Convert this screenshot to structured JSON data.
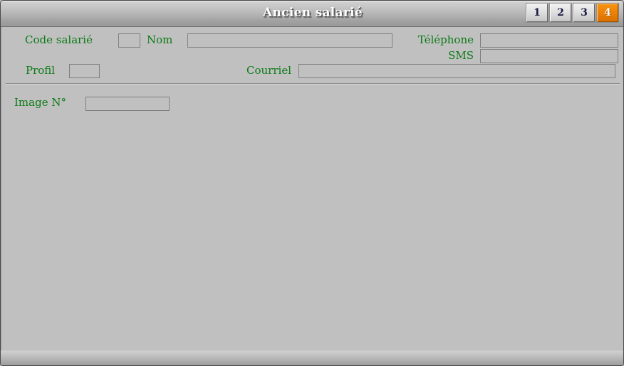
{
  "window": {
    "title": "Ancien salarié"
  },
  "tabs": [
    {
      "label": "1",
      "active": false
    },
    {
      "label": "2",
      "active": false
    },
    {
      "label": "3",
      "active": false
    },
    {
      "label": "4",
      "active": true
    }
  ],
  "form": {
    "code_salarie": {
      "label": "Code salarié",
      "value": "",
      "placeholder": ""
    },
    "nom": {
      "label": "Nom",
      "value": "",
      "placeholder": ""
    },
    "telephone": {
      "label": "Téléphone",
      "value": "",
      "placeholder": ""
    },
    "sms": {
      "label": "SMS",
      "value": "",
      "placeholder": ""
    },
    "profil": {
      "label": "Profil",
      "value": "",
      "placeholder": ""
    },
    "courriel": {
      "label": "Courriel",
      "value": "",
      "placeholder": ""
    },
    "image_no": {
      "label": "Image N°",
      "value": "",
      "placeholder": ""
    }
  },
  "colors": {
    "label_green": "#0b7a14",
    "accent_orange": "#ef8408",
    "surface_gray": "#c0c0c0",
    "border_gray": "#808080"
  },
  "statusbar": {
    "text": ""
  }
}
